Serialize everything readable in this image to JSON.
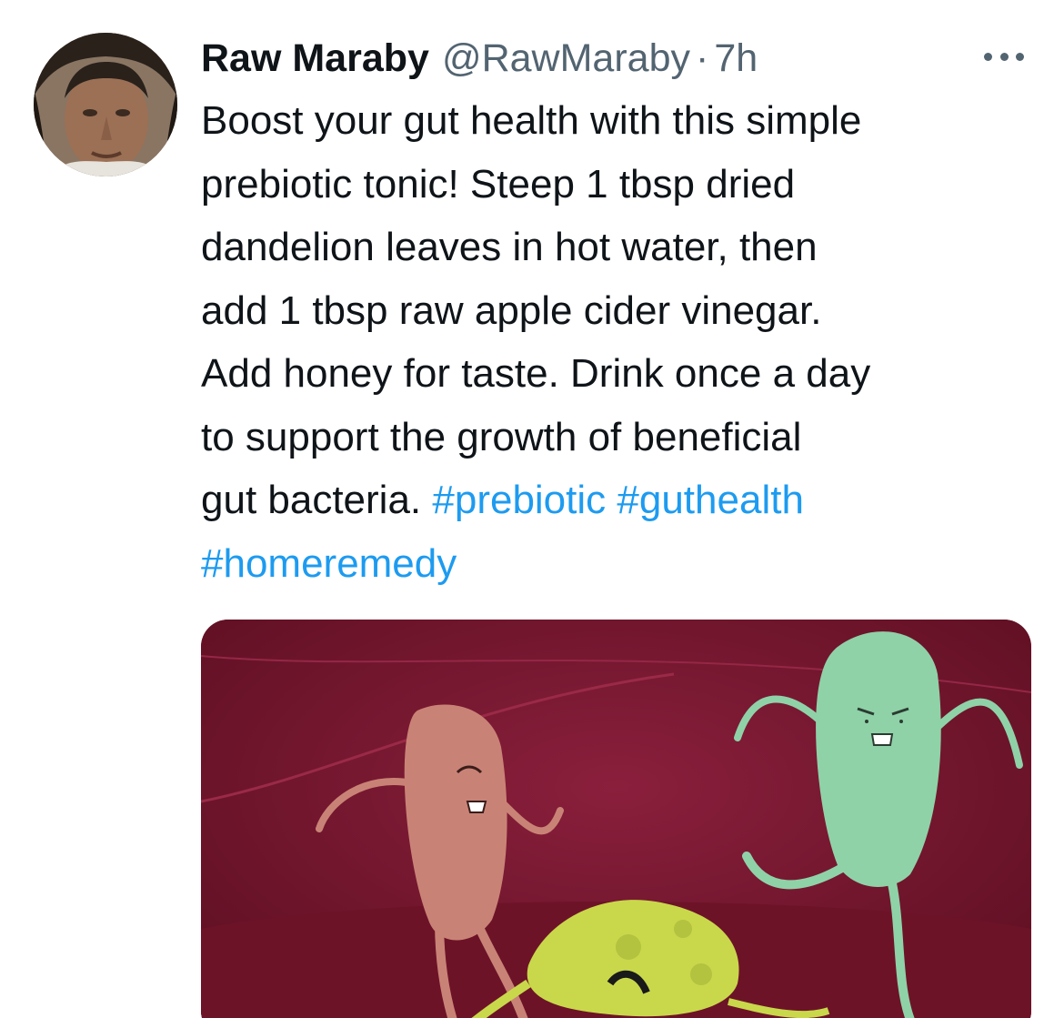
{
  "tweet": {
    "display_name": "Raw Maraby",
    "handle": "@RawMaraby",
    "separator": "·",
    "time": "7h",
    "text_lines": [
      "Boost your gut health with this simple",
      "prebiotic tonic! Steep 1 tbsp dried",
      "dandelion leaves in hot water, then",
      "add 1 tbsp raw apple cider vinegar.",
      "Add honey for taste. Drink once a day",
      "to support the growth of beneficial",
      "gut bacteria. "
    ],
    "hashtags": [
      "#prebiotic",
      "#guthealth",
      "#homeremedy"
    ],
    "media_kind": "animated-bacteria-illustration"
  },
  "icons": {
    "more": "more-horizontal-icon",
    "avatar": "profile-photo"
  },
  "colors": {
    "text": "#0f1419",
    "secondary": "#536471",
    "link": "#1d9bf0",
    "media_bg": "#7a1430"
  }
}
